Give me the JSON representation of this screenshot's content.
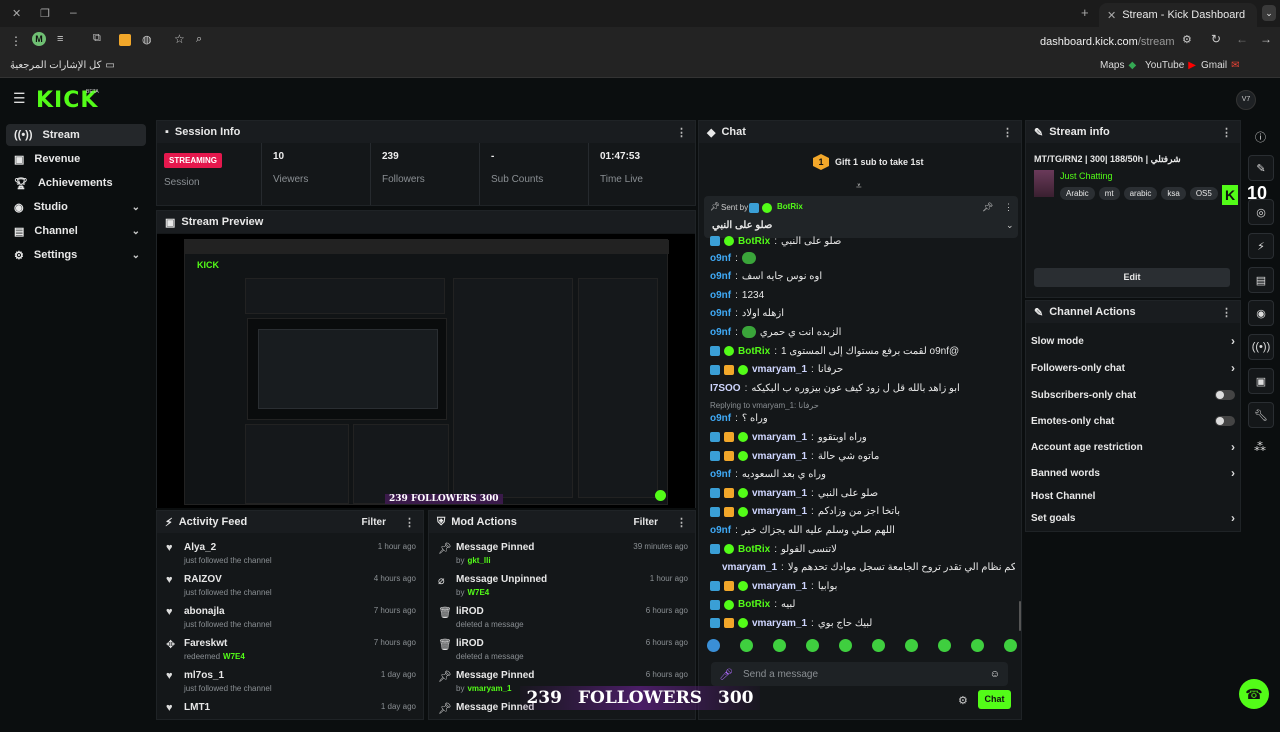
{
  "browser": {
    "tab_title": "Stream - Kick Dashboard",
    "url_domain": "dashboard.kick.com",
    "url_path": "/stream",
    "bookmarks_all": "كل الإشارات المرجعية",
    "bookmarks": [
      "Maps",
      "YouTube",
      "Gmail"
    ],
    "profile_initial": "M"
  },
  "app": {
    "logo": "KICK",
    "logo_sup": "BETA",
    "avatar_initials": "V7"
  },
  "sidebar": {
    "items": [
      {
        "label": "Stream",
        "icon": "stream-icon",
        "active": true
      },
      {
        "label": "Revenue",
        "icon": "revenue-icon"
      },
      {
        "label": "Achievements",
        "icon": "trophy-icon"
      },
      {
        "label": "Studio",
        "icon": "studio-icon",
        "expandable": true
      },
      {
        "label": "Channel",
        "icon": "channel-icon",
        "expandable": true
      },
      {
        "label": "Settings",
        "icon": "gear-icon",
        "expandable": true
      }
    ]
  },
  "session": {
    "title": "Session Info",
    "status": "STREAMING",
    "status_label": "Session",
    "stats": [
      {
        "value": "10",
        "label": "Viewers"
      },
      {
        "value": "239",
        "label": "Followers"
      },
      {
        "value": "-",
        "label": "Sub Counts"
      },
      {
        "value": "01:47:53",
        "label": "Time Live"
      }
    ]
  },
  "preview": {
    "title": "Stream Preview",
    "overlay_count": "239",
    "overlay_label": "FOLLOWERS",
    "overlay_goal": "300"
  },
  "activity": {
    "title": "Activity Feed",
    "filter": "Filter",
    "rows": [
      {
        "name": "Alya_2",
        "sub": "just followed the channel",
        "time": "1 hour ago"
      },
      {
        "name": "RAIZOV",
        "sub": "just followed the channel",
        "time": "4 hours ago"
      },
      {
        "name": "abonajla",
        "sub": "just followed the channel",
        "time": "7 hours ago"
      },
      {
        "name": "Fareskwt",
        "sub": "redeemed",
        "sub_hl": "W7E4",
        "time": "7 hours ago"
      },
      {
        "name": "ml7os_1",
        "sub": "just followed the channel",
        "time": "1 day ago"
      },
      {
        "name": "LMT1",
        "sub": "",
        "time": "1 day ago"
      }
    ]
  },
  "mod": {
    "title": "Mod Actions",
    "filter": "Filter",
    "rows": [
      {
        "action": "Message Pinned",
        "by": "by",
        "user": "gkt_lli",
        "time": "39 minutes ago"
      },
      {
        "action": "Message Unpinned",
        "by": "by",
        "user": "W7E4",
        "time": "1 hour ago"
      },
      {
        "action": "liROD",
        "by": "deleted a message",
        "user": "",
        "time": "6 hours ago"
      },
      {
        "action": "liROD",
        "by": "deleted a message",
        "user": "",
        "time": "6 hours ago"
      },
      {
        "action": "Message Pinned",
        "by": "by",
        "user": "vmaryam_1",
        "time": "6 hours ago"
      },
      {
        "action": "Message Pinned",
        "by": "",
        "user": "",
        "time": ""
      }
    ]
  },
  "chat": {
    "title": "Chat",
    "gift_text": "Gift 1 sub to take 1st",
    "gift_rank": "1",
    "pinned_sent_by": "Sent by",
    "pinned_user": "BotRix",
    "pinned_msg": "صلو على النبي",
    "replying": "Replying to vmaryam_1: حرفانا",
    "input_placeholder": "Send a message",
    "send_label": "Chat",
    "messages": [
      {
        "user": "BotRix",
        "badges": "bv",
        "text": "صلو على النبي",
        "cls": "u-bot"
      },
      {
        "user": "o9nf",
        "badges": "",
        "text": "",
        "cls": "u-blue"
      },
      {
        "user": "o9nf",
        "badges": "",
        "text": "اوه نوس جايه اسف",
        "cls": "u-blue"
      },
      {
        "user": "o9nf",
        "badges": "",
        "text": "1234",
        "cls": "u-blue"
      },
      {
        "user": "o9nf",
        "badges": "",
        "text": "ازهله اولاد",
        "cls": "u-blue"
      },
      {
        "user": "o9nf",
        "badges": "",
        "text": "الزبده انت ي حمري",
        "cls": "u-blue"
      },
      {
        "user": "BotRix",
        "badges": "bv",
        "text": "@o9nf لقمت برفع مستواك إلى المستوى 1",
        "cls": "u-bot"
      },
      {
        "user": "vmaryam_1",
        "badges": "bgv",
        "text": "حرفانا",
        "cls": "u-pale"
      },
      {
        "user": "I7SOO",
        "badges": "",
        "text": "ابو زاهد بالله قل ل زود كيف عون بيزوره ب البكيكه",
        "cls": "u-pale"
      },
      {
        "user": "o9nf",
        "badges": "",
        "text": "وراه ؟",
        "cls": "u-blue"
      },
      {
        "user": "vmaryam_1",
        "badges": "bgv",
        "text": "وراه اوبتقوو",
        "cls": "u-pale"
      },
      {
        "user": "vmaryam_1",
        "badges": "bgv",
        "text": "ماتوه شي حالة",
        "cls": "u-pale"
      },
      {
        "user": "o9nf",
        "badges": "",
        "text": "وراه ي بعد السعوديه",
        "cls": "u-blue"
      },
      {
        "user": "vmaryam_1",
        "badges": "bgv",
        "text": "صلو على النبي",
        "cls": "u-pale"
      },
      {
        "user": "vmaryam_1",
        "badges": "bgv",
        "text": "باتخا اجز من وزادكم",
        "cls": "u-pale"
      },
      {
        "user": "o9nf",
        "badges": "",
        "text": "اللهم صلي وسلم عليه الله يجزاك خير",
        "cls": "u-blue"
      },
      {
        "user": "BotRix",
        "badges": "bv",
        "text": "لاتنسى الفولو",
        "cls": "u-bot"
      },
      {
        "user": "vmaryam_1",
        "badges": "bgv",
        "text": "انتو حتحكم نظام الي تقدر تروح الجامعة تسجل موادك تحدهم ولا",
        "cls": "u-pale"
      },
      {
        "user": "vmaryam_1",
        "badges": "bgv",
        "text": "بوابيا",
        "cls": "u-pale"
      },
      {
        "user": "BotRix",
        "badges": "bv",
        "text": "لبيه",
        "cls": "u-bot"
      },
      {
        "user": "vmaryam_1",
        "badges": "bgv",
        "text": "لبيك حاج بوي",
        "cls": "u-pale"
      }
    ]
  },
  "stream_info": {
    "title": "Stream info",
    "stream_title": "MT/TG/RN2 | 300| 188/50h | شرفتلي",
    "category": "Just Chatting",
    "tags": [
      "Arabic",
      "mt",
      "arabic",
      "ksa",
      "OS5"
    ],
    "edit_label": "Edit",
    "overlay_count": "10"
  },
  "channel_actions": {
    "title": "Channel Actions",
    "items": [
      {
        "label": "Slow mode",
        "kind": "chevron"
      },
      {
        "label": "Followers-only chat",
        "kind": "chevron"
      },
      {
        "label": "Subscribers-only chat",
        "kind": "toggle"
      },
      {
        "label": "Emotes-only chat",
        "kind": "toggle"
      },
      {
        "label": "Account age restriction",
        "kind": "chevron"
      },
      {
        "label": "Banned words",
        "kind": "chevron"
      },
      {
        "label": "Host Channel",
        "kind": "none"
      },
      {
        "label": "Set goals",
        "kind": "chevron"
      }
    ]
  },
  "overlay": {
    "count": "239",
    "label": "FOLLOWERS",
    "goal": "300"
  },
  "colors": {
    "brand": "#53fc18",
    "streaming": "#e5184d",
    "bot": "#53fc18",
    "user": "#3fa9f5"
  }
}
